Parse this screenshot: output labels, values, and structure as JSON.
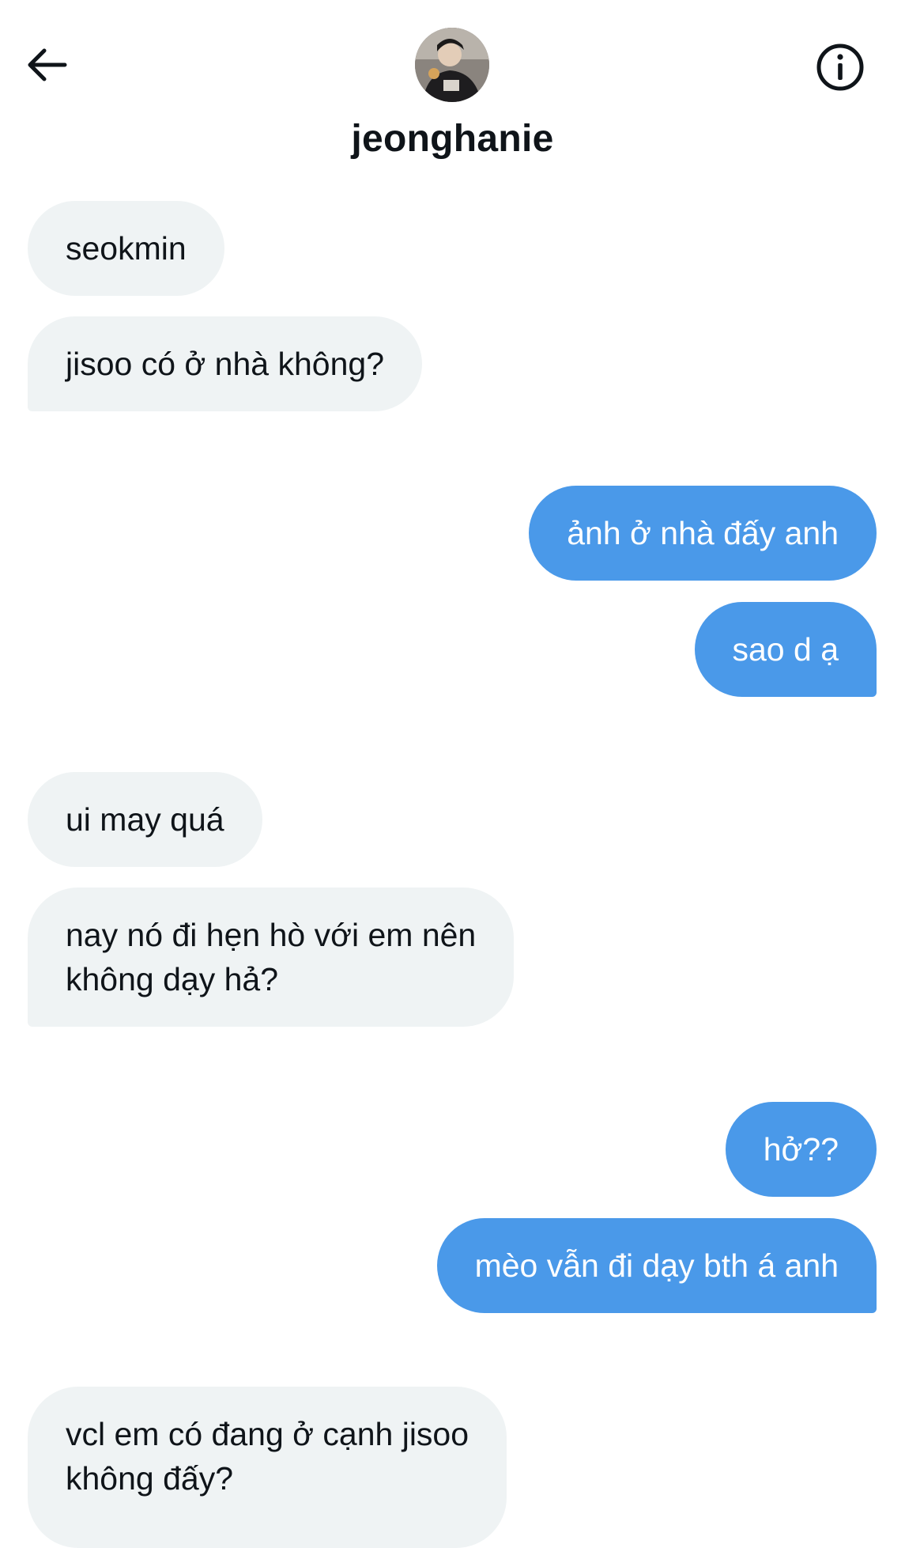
{
  "header": {
    "contact_name": "jeonghanie",
    "avatar": "profile-photo",
    "back_icon": "arrow-left-icon",
    "info_icon": "info-circle-icon"
  },
  "messages": [
    {
      "sender": "contact",
      "text": "seokmin"
    },
    {
      "sender": "contact",
      "text": "jisoo có ở nhà không?"
    },
    {
      "sender": "me",
      "text": "ảnh ở nhà đấy anh"
    },
    {
      "sender": "me",
      "text": "sao d ạ"
    },
    {
      "sender": "contact",
      "text": "ui may quá"
    },
    {
      "sender": "contact",
      "lines": [
        "nay nó đi hẹn hò với em nên",
        "không dạy hả?"
      ]
    },
    {
      "sender": "me",
      "text": "hở??"
    },
    {
      "sender": "me",
      "text": "mèo vẫn đi dạy bth á anh"
    },
    {
      "sender": "contact",
      "lines": [
        "vcl em có đang ở cạnh jisoo",
        "không đấy?"
      ]
    }
  ],
  "colors": {
    "incoming_bubble": "#eff3f4",
    "outgoing_bubble": "#4a99e9",
    "outgoing_text": "#ffffff",
    "text": "#0f1419"
  }
}
